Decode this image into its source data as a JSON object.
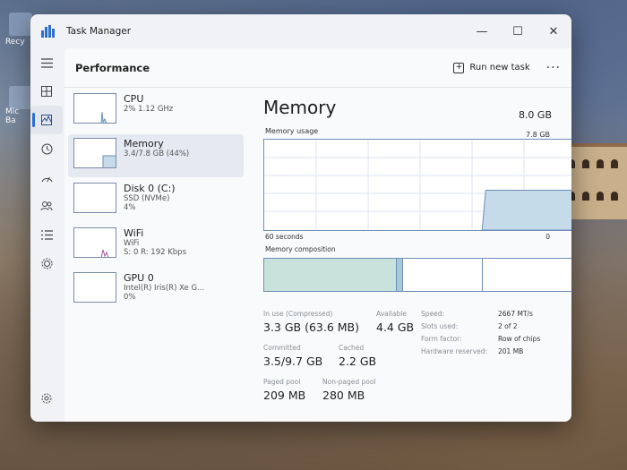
{
  "desktop": {
    "icon_labels": [
      "Recy",
      "Mic",
      "Ba"
    ]
  },
  "window": {
    "title": "Task Manager",
    "controls": {
      "minimize": "—",
      "maximize": "☐",
      "close": "✕"
    }
  },
  "header": {
    "page_title": "Performance",
    "run_new_task_label": "Run new task",
    "more_label": "···"
  },
  "rail": {
    "items": [
      "hamburger-icon",
      "processes-icon",
      "performance-icon",
      "app-history-icon",
      "startup-icon",
      "users-icon",
      "details-icon",
      "services-icon"
    ],
    "active": "performance-icon",
    "settings_icon": "gear-icon"
  },
  "resources": [
    {
      "name": "CPU",
      "sub1": "2%  1.12 GHz",
      "sub2": ""
    },
    {
      "name": "Memory",
      "sub1": "3.4/7.8 GB (44%)",
      "sub2": ""
    },
    {
      "name": "Disk 0 (C:)",
      "sub1": "SSD (NVMe)",
      "sub2": "4%"
    },
    {
      "name": "WiFi",
      "sub1": "WiFi",
      "sub2": "S: 0  R: 192 Kbps"
    },
    {
      "name": "GPU 0",
      "sub1": "Intel(R) Iris(R) Xe G...",
      "sub2": "0%"
    }
  ],
  "selected_resource": "Memory",
  "detail": {
    "title": "Memory",
    "total": "8.0 GB",
    "usage_label": "Memory usage",
    "usage_max": "7.8 GB",
    "axis_left": "60 seconds",
    "axis_right": "0",
    "composition_label": "Memory composition",
    "usage_level_fraction": 0.44,
    "composition_fractions": {
      "in_use": 0.43,
      "modified": 0.02,
      "standby": 0.26,
      "free": 0.29
    }
  },
  "stats": {
    "in_use_label": "In use (Compressed)",
    "in_use_value": "3.3 GB (63.6 MB)",
    "available_label": "Available",
    "available_value": "4.4 GB",
    "committed_label": "Committed",
    "committed_value": "3.5/9.7 GB",
    "cached_label": "Cached",
    "cached_value": "2.2 GB",
    "paged_label": "Paged pool",
    "paged_value": "209 MB",
    "nonpaged_label": "Non-paged pool",
    "nonpaged_value": "280 MB"
  },
  "specs": [
    {
      "key": "Speed:",
      "value": "2667 MT/s"
    },
    {
      "key": "Slots used:",
      "value": "2 of 2"
    },
    {
      "key": "Form factor:",
      "value": "Row of chips"
    },
    {
      "key": "Hardware reserved:",
      "value": "201 MB"
    }
  ],
  "colors": {
    "accent": "#2d6fcf",
    "memory_fill": "#c5dbea",
    "memory_line": "#6f8fb8",
    "composition_in_use": "#c7e3dc"
  }
}
